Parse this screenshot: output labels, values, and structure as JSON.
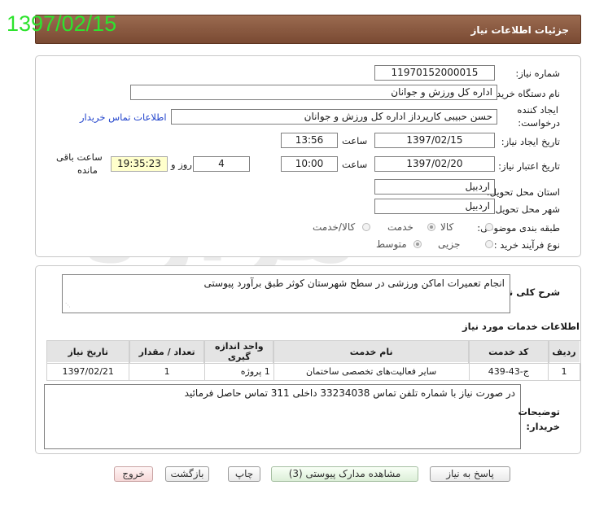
{
  "watermark_date": "1397/02/15",
  "header": {
    "title": "جزئیات اطلاعات نیاز"
  },
  "labels": {
    "need_number": "شماره نیاز:",
    "buyer_org": "نام دستگاه خریدار:",
    "creator_line1": "ایجاد کننده",
    "creator_line2": "درخواست:",
    "contact_link": "اطلاعات تماس خریدار",
    "created_date": "تاریخ ایجاد نیاز:",
    "hour": "ساعت",
    "validity_date": "تاریخ اعتبار نیاز:",
    "days_and": "روز و",
    "remaining_line1": "ساعت باقی",
    "remaining_line2": "مانده",
    "province": "استان محل تحویل:",
    "city": "شهر محل تحویل:",
    "category": "طبقه بندی موضوعی:",
    "purchase_type": "نوع فرآیند خرید :",
    "overall_desc": "شرح کلی نیاز:",
    "services_info": "اطلاعات خدمات مورد نیاز",
    "buyer_notes_line1": "توضیحات",
    "buyer_notes_line2": "خریدار:"
  },
  "values": {
    "need_number": "11970152000015",
    "buyer_org": "اداره کل ورزش و جوانان",
    "creator": "حسن حبیبی کارپرداز اداره کل ورزش و جوانان",
    "created_date": "1397/02/15",
    "created_time": "13:56",
    "validity_date": "1397/02/20",
    "validity_time": "10:00",
    "remaining_days": "4",
    "remaining_time": "19:35:23",
    "province": "اردبیل",
    "city": "اردبیل",
    "overall_desc": "انجام تعمیرات اماکن ورزشی در سطح شهرستان کوثر طبق برآورد پیوستی",
    "buyer_notes": "در صورت نیاز با شماره تلفن تماس 33234038 داخلی 311 تماس حاصل فرمائید"
  },
  "category_options": [
    "کالا",
    "خدمت",
    "کالا/خدمت"
  ],
  "category_selected": "خدمت",
  "purchase_options": [
    "جزیی",
    "متوسط"
  ],
  "purchase_selected": "متوسط",
  "table": {
    "headers": [
      "ردیف",
      "کد خدمت",
      "نام خدمت",
      "واحد اندازه گیری",
      "تعداد / مقدار",
      "تاریخ نیاز"
    ],
    "rows": [
      [
        "1",
        "ج-43-439",
        "سایر فعالیت‌های تخصصی ساختمان",
        "1 پروژه",
        "1",
        "1397/02/21"
      ]
    ]
  },
  "buttons": {
    "reply": "پاسخ به نیاز",
    "attachments": "مشاهده مدارک پیوستی (3)",
    "print": "چاپ",
    "back": "بازگشت",
    "exit": "خروج"
  },
  "colors": {
    "header_bg": "#8a5a40",
    "date_watermark": "#2ee32e",
    "time_box": "#ffffcc",
    "link": "#2244cc"
  }
}
